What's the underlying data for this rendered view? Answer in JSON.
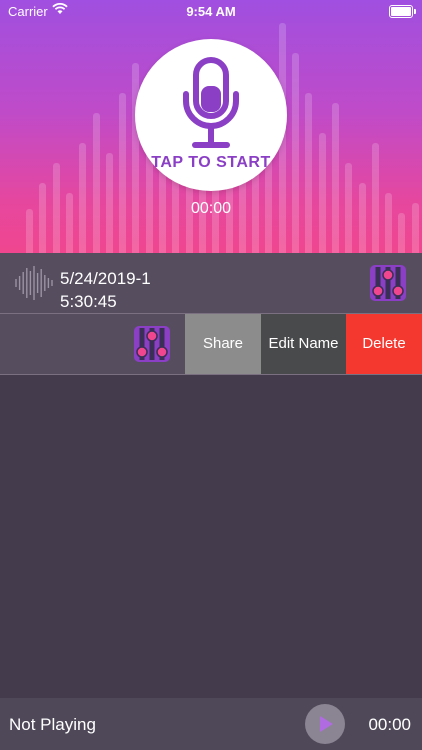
{
  "status_bar": {
    "carrier": "Carrier",
    "time": "9:54 AM"
  },
  "recorder": {
    "button_label": "TAP TO START",
    "timer": "00:00"
  },
  "recordings": [
    {
      "name": "5/24/2019-1",
      "duration": "5:30:45"
    }
  ],
  "swipe_actions": {
    "share": "Share",
    "edit_name": "Edit Name",
    "delete": "Delete"
  },
  "player": {
    "status": "Not Playing",
    "time": "00:00"
  },
  "colors": {
    "gradient_top": "#a04fe0",
    "gradient_bottom": "#f0468f",
    "background": "#443c4d",
    "delete": "#f5382f",
    "share": "#8d8c8c",
    "edit": "#494a4c",
    "accent_purple": "#8a3fc5",
    "eq_pink": "#f0468f"
  },
  "icons": [
    "wifi-icon",
    "battery-icon",
    "microphone-icon",
    "waveform-icon",
    "equalizer-icon",
    "play-icon"
  ]
}
